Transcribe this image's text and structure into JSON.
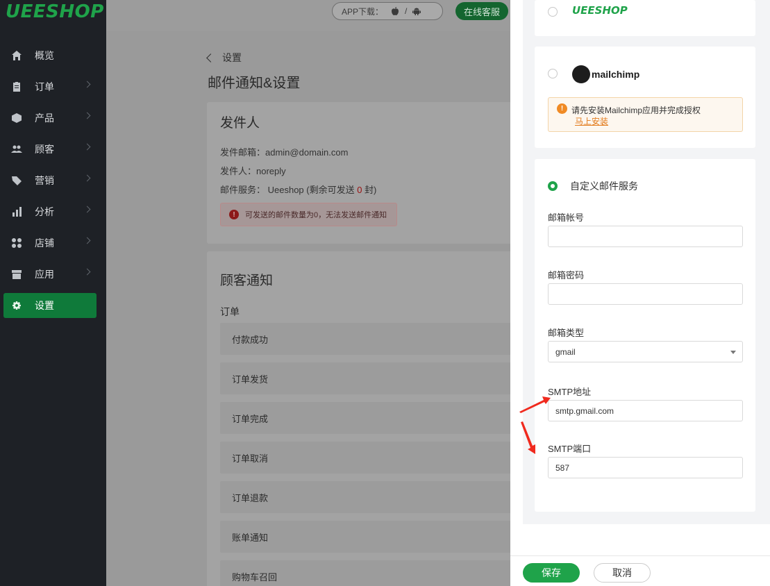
{
  "brand": {
    "logo_text": "UEESHOP",
    "accent": "#1fa34a"
  },
  "sidebar": {
    "items": [
      {
        "label": "概览",
        "icon": "home-icon"
      },
      {
        "label": "订单",
        "icon": "clipboard-icon"
      },
      {
        "label": "产品",
        "icon": "cube-icon"
      },
      {
        "label": "顾客",
        "icon": "users-icon"
      },
      {
        "label": "营销",
        "icon": "tag-icon"
      },
      {
        "label": "分析",
        "icon": "bar-chart-icon"
      },
      {
        "label": "店铺",
        "icon": "grid-icon"
      },
      {
        "label": "应用",
        "icon": "store-icon"
      },
      {
        "label": "设置",
        "icon": "gear-icon"
      }
    ],
    "active": "设置"
  },
  "topbar": {
    "app_download": "APP下载：",
    "app_sep": "/",
    "support": "在线客服"
  },
  "page": {
    "breadcrumb": "设置",
    "title": "邮件通知&设置",
    "sender": {
      "heading": "发件人",
      "email_line": "发件邮箱：admin@domain.com",
      "name_line": "发件人：noreply",
      "service_prefix": "邮件服务： Ueeshop (剩余可发送 ",
      "service_count": "0",
      "service_suffix": " 封)",
      "alert": "可发送的邮件数量为0，无法发送邮件通知"
    },
    "customer": {
      "heading": "顾客通知",
      "section": "订单",
      "rows": [
        "付款成功",
        "订单发货",
        "订单完成",
        "订单取消",
        "订单退款",
        "账单通知",
        "购物车召回"
      ]
    }
  },
  "drawer": {
    "ueeshop_logo": "UEESHOP",
    "mailchimp_logo": "mailchimp",
    "mailchimp_warning": "请先安装Mailchimp应用并完成授权",
    "mailchimp_link": "马上安装",
    "custom_label": "自定义邮件服务",
    "fields": {
      "account_label": "邮箱帐号",
      "account_value": "",
      "password_label": "邮箱密码",
      "password_value": "",
      "type_label": "邮箱类型",
      "type_value": "gmail",
      "smtp_label": "SMTP地址",
      "smtp_value": "smtp.gmail.com",
      "port_label": "SMTP端口",
      "port_value": "587"
    },
    "save": "保存",
    "cancel": "取消"
  }
}
